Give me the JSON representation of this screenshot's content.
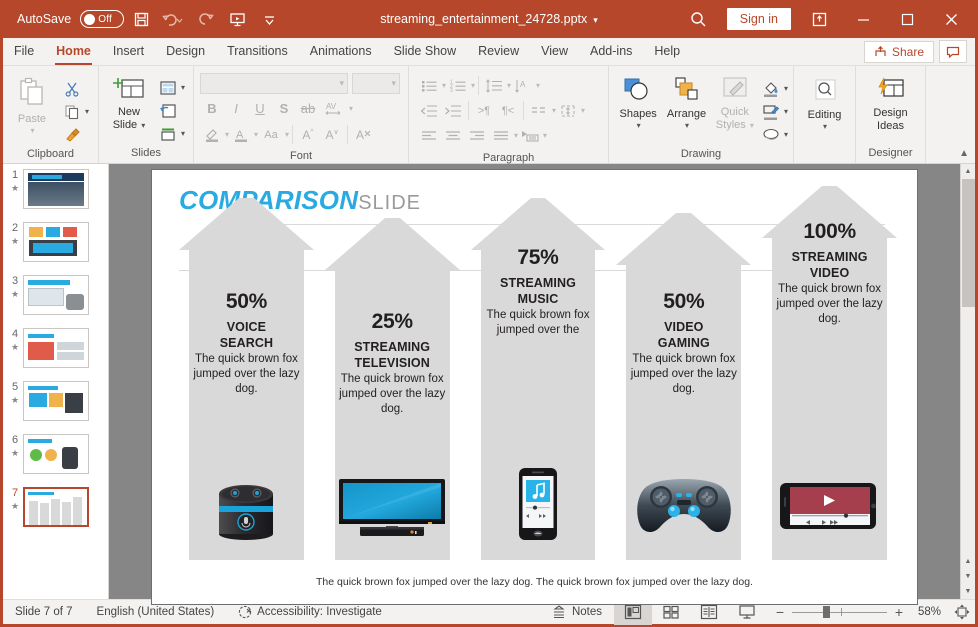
{
  "titlebar": {
    "autosave_label": "AutoSave",
    "autosave_state": "Off",
    "filename": "streaming_entertainment_24728.pptx",
    "caret": "▾",
    "signin_label": "Sign in",
    "qat": [
      {
        "name": "save-icon",
        "title": "Save"
      },
      {
        "name": "undo-icon",
        "title": "Undo"
      },
      {
        "name": "redo-icon",
        "title": "Redo"
      },
      {
        "name": "start-presentation-icon",
        "title": "Start From Beginning"
      },
      {
        "name": "customize-qat-icon",
        "title": "Customize Quick Access Toolbar"
      }
    ],
    "window_controls": [
      "search-icon",
      "ribbon-display-icon",
      "minimize-icon",
      "maximize-icon",
      "close-icon"
    ]
  },
  "tabs": [
    {
      "label": "File",
      "active": false
    },
    {
      "label": "Home",
      "active": true
    },
    {
      "label": "Insert",
      "active": false
    },
    {
      "label": "Design",
      "active": false
    },
    {
      "label": "Transitions",
      "active": false
    },
    {
      "label": "Animations",
      "active": false
    },
    {
      "label": "Slide Show",
      "active": false
    },
    {
      "label": "Review",
      "active": false
    },
    {
      "label": "View",
      "active": false
    },
    {
      "label": "Add-ins",
      "active": false
    },
    {
      "label": "Help",
      "active": false
    }
  ],
  "tabs_right": {
    "share_label": "Share",
    "comments_label": ""
  },
  "ribbon": {
    "groups": [
      {
        "label": "Clipboard",
        "paste_label": "Paste"
      },
      {
        "label": "Slides",
        "new_slide_label": "New\nSlide"
      },
      {
        "label": "Font"
      },
      {
        "label": "Paragraph"
      },
      {
        "label": "Drawing",
        "shapes_label": "Shapes",
        "arrange_label": "Arrange",
        "quick_styles_label": "Quick\nStyles"
      },
      {
        "label": "Designer",
        "editing_label": "Editing",
        "design_ideas_label": "Design\nIdeas"
      }
    ],
    "clipboard": {
      "paste": "Paste"
    },
    "slides": {
      "new_slide_line1": "New",
      "new_slide_line2": "Slide"
    },
    "drawing": {
      "shapes": "Shapes",
      "arrange": "Arrange",
      "quick_line1": "Quick",
      "quick_line2": "Styles"
    },
    "designer": {
      "editing": "Editing",
      "ideas_line1": "Design",
      "ideas_line2": "Ideas"
    }
  },
  "thumbnails": {
    "selected": 7,
    "items": [
      {
        "number": "1"
      },
      {
        "number": "2"
      },
      {
        "number": "3"
      },
      {
        "number": "4"
      },
      {
        "number": "5"
      },
      {
        "number": "6"
      },
      {
        "number": "7"
      }
    ]
  },
  "slide": {
    "title_main": "COMPARISON",
    "title_sub": "SLIDE",
    "caption": "The quick brown fox jumped over the lazy dog. The quick brown fox jumped over the lazy dog.",
    "accent_color": "#29ABE2",
    "arrow_color": "#d9d9d9",
    "columns": [
      {
        "percent": "50%",
        "heading_line1": "VOICE",
        "heading_line2": "SEARCH",
        "body": "The quick brown fox jumped over the lazy dog.",
        "device": "smart-speaker-icon"
      },
      {
        "percent": "25%",
        "heading_line1": "STREAMING",
        "heading_line2": "TELEVISION",
        "body": "The quick brown fox jumped over the lazy dog.",
        "device": "television-icon"
      },
      {
        "percent": "75%",
        "heading_line1": "STREAMING",
        "heading_line2": "MUSIC",
        "body": "The quick brown fox jumped over the",
        "device": "smartphone-music-icon"
      },
      {
        "percent": "50%",
        "heading_line1": "VIDEO",
        "heading_line2": "GAMING",
        "body": "The quick brown fox jumped over the lazy dog.",
        "device": "game-controller-icon"
      },
      {
        "percent": "100%",
        "heading_line1": "STREAMING",
        "heading_line2": "VIDEO",
        "body": "The quick brown fox jumped over the lazy dog.",
        "device": "smartphone-video-icon"
      }
    ]
  },
  "status": {
    "slide_counter": "Slide 7 of 7",
    "language": "English (United States)",
    "accessibility": "Accessibility: Investigate",
    "notes_label": "Notes",
    "zoom_percent": "58%",
    "views": [
      {
        "name": "normal-view-button",
        "active": true
      },
      {
        "name": "slide-sorter-view-button",
        "active": false
      },
      {
        "name": "reading-view-button",
        "active": false
      },
      {
        "name": "slide-show-button",
        "active": false
      }
    ]
  }
}
